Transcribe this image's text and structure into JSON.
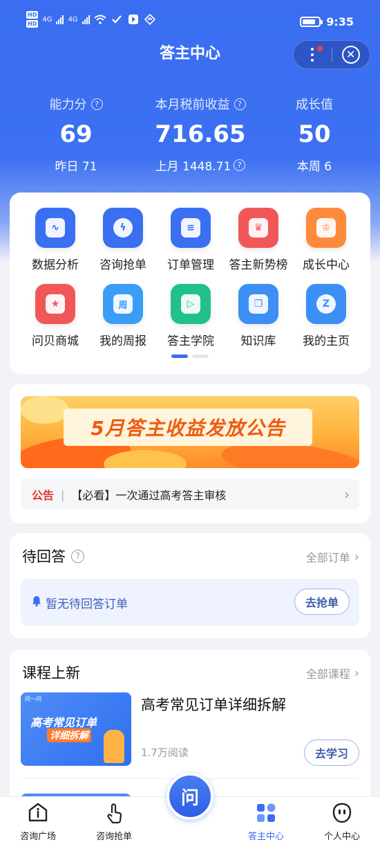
{
  "status_bar": {
    "hd_labels": [
      "HD",
      "HD"
    ],
    "network_1": "4G",
    "network_2": "4G",
    "time": "9:35"
  },
  "header": {
    "title": "答主中心"
  },
  "stats": [
    {
      "label": "能力分",
      "value": "69",
      "sub": "昨日 71"
    },
    {
      "label": "本月税前收益",
      "value": "716.65",
      "sub": "上月 1448.71"
    },
    {
      "label": "成长值",
      "value": "50",
      "sub": "本周 6"
    }
  ],
  "grid": [
    {
      "label": "数据分析",
      "icon": "chart-icon",
      "color": "#3b6ff2"
    },
    {
      "label": "咨询抢单",
      "icon": "lightning-icon",
      "color": "#3b6ff2"
    },
    {
      "label": "订单管理",
      "icon": "document-icon",
      "color": "#3b6ff2"
    },
    {
      "label": "答主新势榜",
      "icon": "trophy-icon",
      "color": "#f25757"
    },
    {
      "label": "成长中心",
      "icon": "crown-icon",
      "color": "#ff8a3d"
    },
    {
      "label": "问贝商城",
      "icon": "shop-icon",
      "color": "#f25757"
    },
    {
      "label": "我的周报",
      "icon": "calendar-icon",
      "color": "#3b9df7"
    },
    {
      "label": "答主学院",
      "icon": "play-icon",
      "color": "#22c08a"
    },
    {
      "label": "知识库",
      "icon": "book-icon",
      "color": "#3b8ff5"
    },
    {
      "label": "我的主页",
      "icon": "profile-icon",
      "color": "#3b8ff5"
    }
  ],
  "grid_glyphs": [
    "∿",
    "ϟ",
    "≡",
    "♛",
    "♔",
    "★",
    "周",
    "▷",
    "❐",
    "Z"
  ],
  "banner": {
    "text": "5月答主收益发放公告"
  },
  "notice": {
    "tag": "公告",
    "separator": "|",
    "text": "【必看】一次通过高考答主审核"
  },
  "pending": {
    "title": "待回答",
    "link": "全部订单",
    "empty_text": "暂无待回答订单",
    "button": "去抢单"
  },
  "courses": {
    "title": "课程上新",
    "link": "全部课程",
    "items": [
      {
        "title": "高考常见订单详细拆解",
        "reads": "1.7万阅读",
        "button": "去学习",
        "thumb_brand": "问一问",
        "thumb_line1": "高考常见订单",
        "thumb_line2": "详细拆解"
      }
    ]
  },
  "tabbar": {
    "items": [
      {
        "label": "咨询广场",
        "icon": "info-icon"
      },
      {
        "label": "咨询抢单",
        "icon": "tap-icon"
      },
      {
        "label": "答主中心",
        "icon": "grid-icon",
        "active": true
      },
      {
        "label": "个人中心",
        "icon": "face-icon"
      }
    ],
    "center_label": "问"
  },
  "colors": {
    "primary": "#3a6df0",
    "notice_tag": "#e2342c",
    "banner_text": "#ef5a12"
  }
}
